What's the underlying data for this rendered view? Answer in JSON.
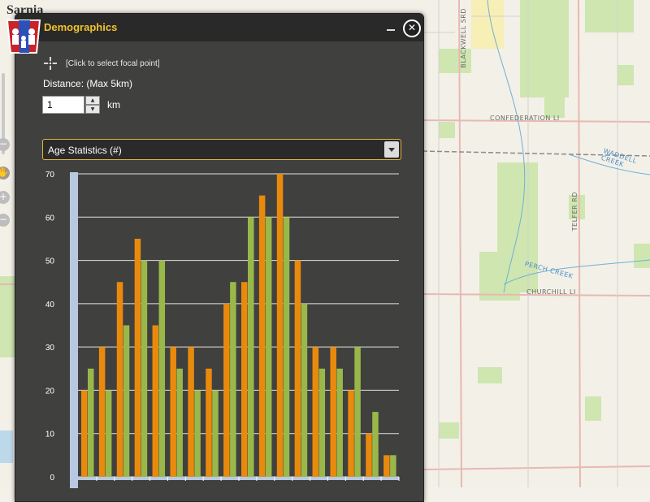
{
  "map": {
    "city": "Sarnia",
    "roads": [
      "BLACKWELL SRD",
      "CONFEDERATION LI",
      "TELFER RD",
      "CHURCHILL LI"
    ],
    "creeks": [
      "WADDELL CREEK",
      "PERCH CREEK"
    ]
  },
  "panel": {
    "title": "Demographics",
    "focal_hint": "[Click to select focal point]",
    "distance_label": "Distance: (Max 5km)",
    "distance_value": "1",
    "unit": "km",
    "selected_statistic": "Age Statistics (#)"
  },
  "colors": {
    "title": "#f2c12e",
    "series_orange": "#e98a0c",
    "series_green": "#9ab84a",
    "axis_bar": "#b7c8e0"
  },
  "icons": [
    "crosshair-icon",
    "close-icon",
    "minimize-icon",
    "dropdown-arrow-icon",
    "pan-hand-icon",
    "zoom-in-icon",
    "zoom-out-icon"
  ],
  "chart_data": {
    "type": "bar",
    "ylim": [
      0,
      70
    ],
    "yticks": [
      0,
      10,
      20,
      30,
      40,
      50,
      60,
      70
    ],
    "grid": true,
    "series": [
      {
        "values": [
          20,
          30,
          45,
          55,
          35,
          30,
          30,
          25,
          40,
          45,
          65,
          70,
          50,
          30,
          30,
          20,
          10,
          5
        ]
      },
      {
        "values": [
          25,
          20,
          35,
          50,
          50,
          25,
          20,
          20,
          45,
          60,
          60,
          60,
          40,
          25,
          25,
          30,
          15,
          5
        ]
      }
    ]
  }
}
